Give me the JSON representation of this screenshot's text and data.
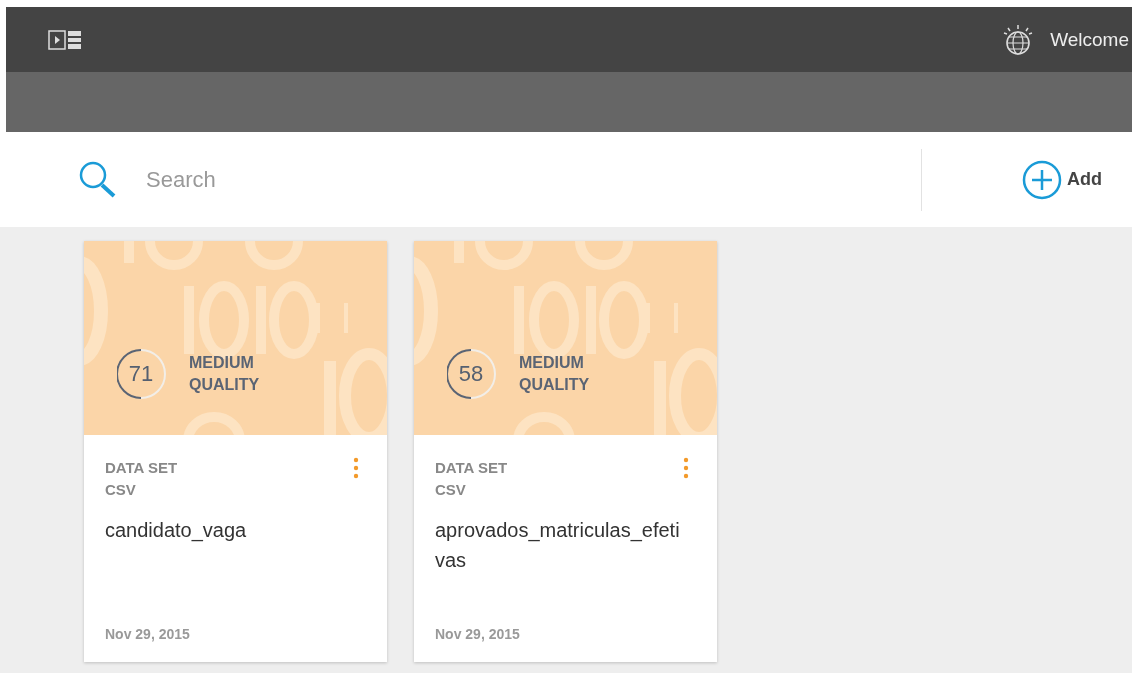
{
  "header": {
    "welcome": "Welcome"
  },
  "search": {
    "placeholder": "Search"
  },
  "add_button": {
    "label": "Add"
  },
  "cards": [
    {
      "score": "71",
      "quality": [
        "MEDIUM",
        "QUALITY"
      ],
      "type": "DATA SET",
      "format": "CSV",
      "name": "candidato_vaga",
      "date": "Nov 29, 2015"
    },
    {
      "score": "58",
      "quality": [
        "MEDIUM",
        "QUALITY"
      ],
      "type": "DATA SET",
      "format": "CSV",
      "name": "aprovados_matriculas_efetivas",
      "date": "Nov 29, 2015"
    }
  ]
}
